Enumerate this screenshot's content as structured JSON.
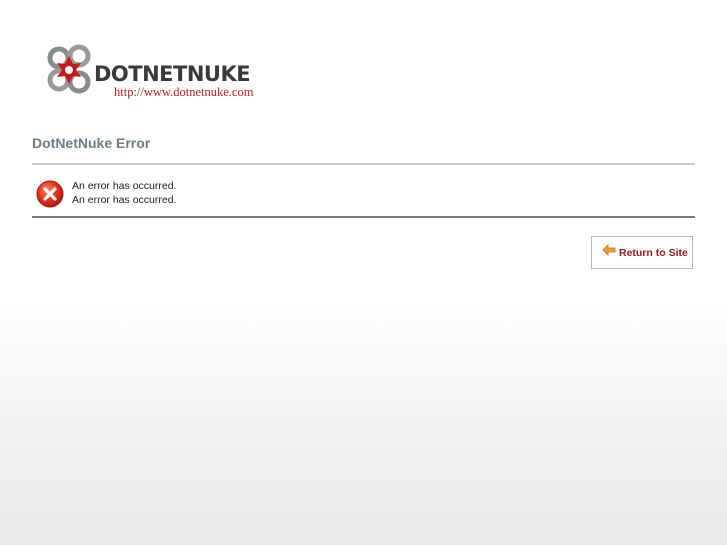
{
  "brand": {
    "name": "DOTNETNUKE",
    "url": "http://www.dotnetnuke.com",
    "logo_icon": "dotnetnuke-logo-icon"
  },
  "page": {
    "title": "DotNetNuke Error"
  },
  "error": {
    "icon": "error-x-icon",
    "lines": [
      "An error has occurred.",
      "An error has occurred."
    ]
  },
  "actions": {
    "return_label": "Return to Site",
    "return_icon": "back-arrow-icon"
  },
  "colors": {
    "title": "#6f7b87",
    "accent_red": "#c41a1a",
    "button_text": "#9e1212",
    "logo_text": "#3a3a3a"
  }
}
